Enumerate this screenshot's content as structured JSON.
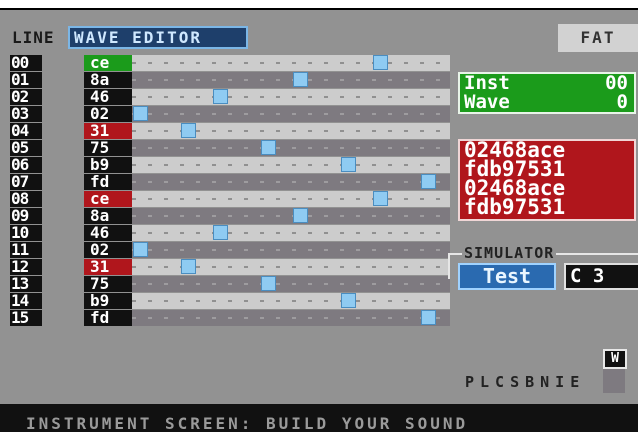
{
  "tabs": {
    "line": "LINE",
    "wave_editor": "WAVE EDITOR",
    "fat": "FAT"
  },
  "rows": [
    {
      "num": "00",
      "val": "ce",
      "hl": "green",
      "step": 15
    },
    {
      "num": "01",
      "val": "8a",
      "hl": "",
      "step": 10
    },
    {
      "num": "02",
      "val": "46",
      "hl": "",
      "step": 5
    },
    {
      "num": "03",
      "val": "02",
      "hl": "",
      "step": 0
    },
    {
      "num": "04",
      "val": "31",
      "hl": "red",
      "step": 3
    },
    {
      "num": "05",
      "val": "75",
      "hl": "",
      "step": 8
    },
    {
      "num": "06",
      "val": "b9",
      "hl": "",
      "step": 13
    },
    {
      "num": "07",
      "val": "fd",
      "hl": "",
      "step": 18
    },
    {
      "num": "08",
      "val": "ce",
      "hl": "red",
      "step": 15
    },
    {
      "num": "09",
      "val": "8a",
      "hl": "",
      "step": 10
    },
    {
      "num": "10",
      "val": "46",
      "hl": "",
      "step": 5
    },
    {
      "num": "11",
      "val": "02",
      "hl": "",
      "step": 0
    },
    {
      "num": "12",
      "val": "31",
      "hl": "red",
      "step": 3
    },
    {
      "num": "13",
      "val": "75",
      "hl": "",
      "step": 8
    },
    {
      "num": "14",
      "val": "b9",
      "hl": "",
      "step": 13
    },
    {
      "num": "15",
      "val": "fd",
      "hl": "",
      "step": 18
    }
  ],
  "inst": {
    "inst_label": "Inst",
    "inst_value": "00",
    "wave_label": "Wave",
    "wave_value": "0"
  },
  "hex_lines": [
    "02468ace",
    "fdb97531",
    "02468ace",
    "fdb97531"
  ],
  "simulator": {
    "title": "SIMULATOR",
    "test_label": "Test",
    "note": "C 3"
  },
  "w_icon": "W",
  "nav_letters": "PLCSBNIE",
  "status": "INSTRUMENT SCREEN: BUILD YOUR SOUND",
  "colors": {
    "green": "#1b9b1b",
    "red": "#b0161c",
    "blue": "#2a6ab0",
    "marker": "#8fcbf2"
  }
}
